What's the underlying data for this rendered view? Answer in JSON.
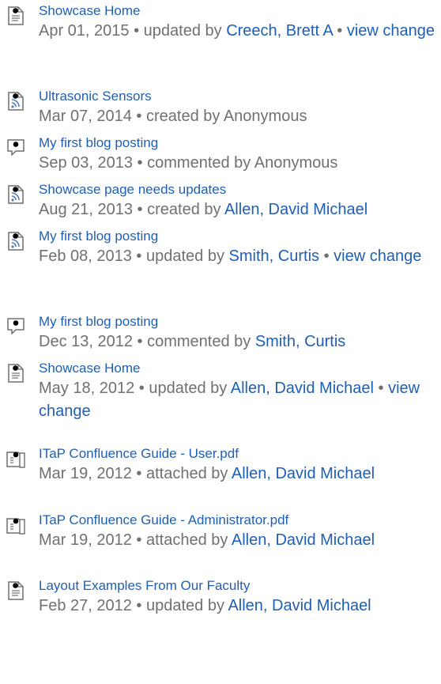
{
  "activity": [
    {
      "type": "page",
      "title": "Showcase Home",
      "date": "Apr 01, 2015",
      "action": "updated by",
      "user": "Creech, Brett A",
      "extra": "view change"
    },
    {
      "type": "blog",
      "title": "Ultrasonic Sensors",
      "date": "Mar 07, 2014",
      "action": "created by",
      "user": "Anonymous",
      "user_linked": false
    },
    {
      "type": "comment",
      "title": "My first blog posting",
      "date": "Sep 03, 2013",
      "action": "commented by",
      "user": "Anonymous",
      "user_linked": false
    },
    {
      "type": "blog",
      "title": "Showcase page needs updates",
      "date": "Aug 21, 2013",
      "action": "created by",
      "user": "Allen, David Michael"
    },
    {
      "type": "blog",
      "title": "My first blog posting",
      "date": "Feb 08, 2013",
      "action": "updated by",
      "user": "Smith, Curtis",
      "extra": "view change"
    },
    {
      "type": "comment",
      "title": "My first blog posting",
      "date": "Dec 13, 2012",
      "action": "commented by",
      "user": "Smith, Curtis"
    },
    {
      "type": "page",
      "title": "Showcase Home",
      "date": "May 18, 2012",
      "action": "updated by",
      "user": "Allen, David Michael",
      "extra": "view change"
    },
    {
      "type": "attachment",
      "title": "ITaP Confluence Guide - User.pdf",
      "date": "Mar 19, 2012",
      "action": "attached by",
      "user": "Allen, David Michael"
    },
    {
      "type": "attachment",
      "title": "ITaP Confluence Guide - Administrator.pdf",
      "date": "Mar 19, 2012",
      "action": "attached by",
      "user": "Allen, David Michael"
    },
    {
      "type": "page",
      "title": "Layout Examples From Our Faculty",
      "date": "Feb 27, 2012",
      "action": "updated by",
      "user": "Allen, David Michael"
    }
  ],
  "colors": {
    "link": "#1f5fb4",
    "meta_text": "#707070",
    "icon_stroke": "#6f6f6f",
    "blog_arc": "#4f7fbf"
  },
  "icons": {
    "page": "page-icon",
    "blog": "blog-post-icon",
    "comment": "comment-icon",
    "attachment": "pdf-attachment-icon"
  }
}
